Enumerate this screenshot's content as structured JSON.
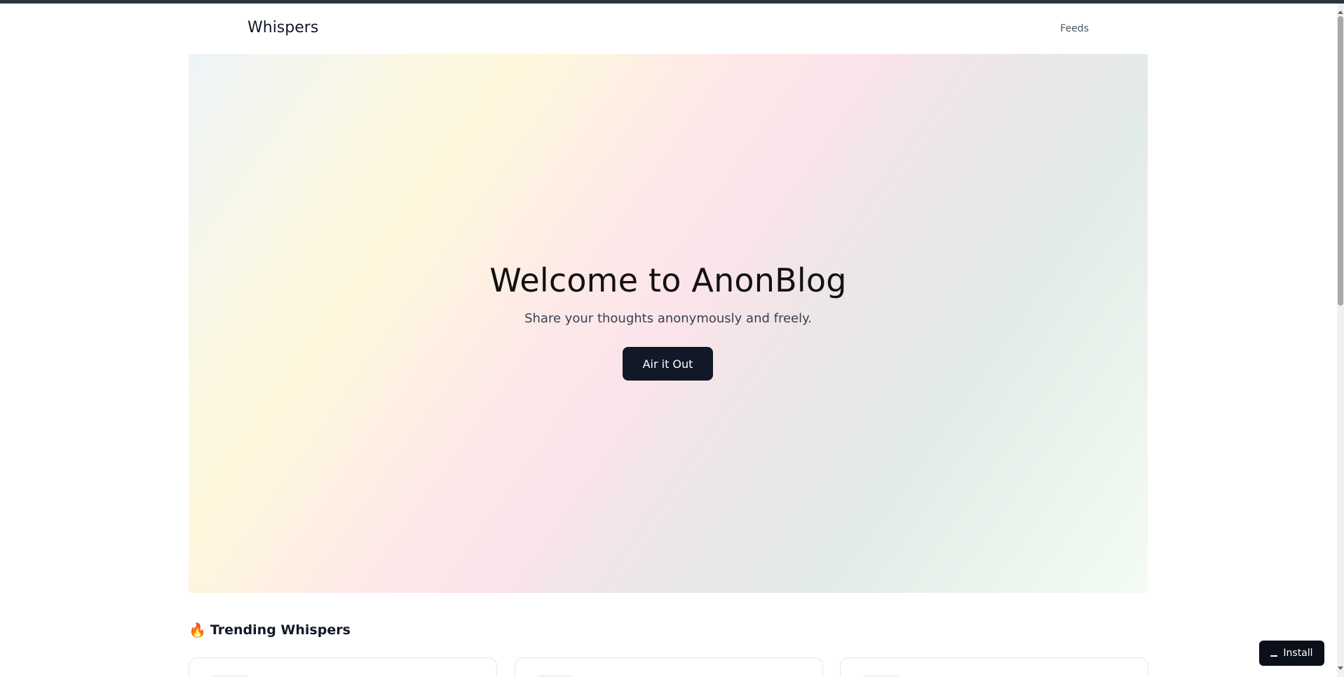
{
  "navbar": {
    "brand": "Whispers",
    "links": [
      {
        "label": "Feeds"
      }
    ]
  },
  "hero": {
    "title": "Welcome to AnonBlog",
    "subtitle": "Share your thoughts anonymously and freely.",
    "cta_label": "Air it Out"
  },
  "trending": {
    "icon": "fire-icon",
    "title": "Trending Whispers",
    "card_count": 3
  },
  "install": {
    "label": "Install",
    "icon": "install-icon"
  },
  "colors": {
    "primary_dark": "#111827",
    "top_bar": "#2b333b"
  }
}
